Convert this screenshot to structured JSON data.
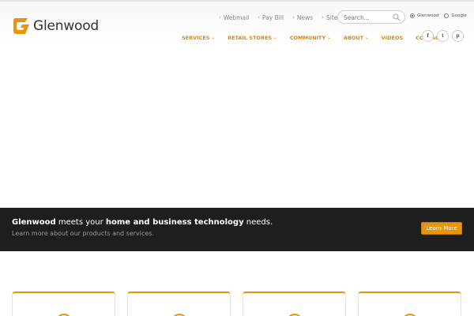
{
  "brand": {
    "name": "Glenwood",
    "accent": "#e8950c"
  },
  "utility_nav": [
    {
      "label": "Webmail"
    },
    {
      "label": "Pay Bill"
    },
    {
      "label": "News"
    },
    {
      "label": "Sites"
    }
  ],
  "search": {
    "placeholder": "Search..."
  },
  "search_scope": [
    {
      "label": "Glenwood",
      "selected": true
    },
    {
      "label": "Google",
      "selected": false
    }
  ],
  "main_nav": [
    {
      "label": "SERVICES",
      "has_dropdown": true
    },
    {
      "label": "RETAIL STORES",
      "has_dropdown": true
    },
    {
      "label": "COMMUNITY",
      "has_dropdown": true
    },
    {
      "label": "ABOUT",
      "has_dropdown": true
    },
    {
      "label": "VIDEOS",
      "has_dropdown": false
    },
    {
      "label": "CONTACT",
      "has_dropdown": false
    }
  ],
  "social": [
    {
      "glyph": "f",
      "icon": "facebook-icon"
    },
    {
      "glyph": "t",
      "icon": "twitter-icon"
    },
    {
      "glyph": "p",
      "icon": "pinterest-icon"
    }
  ],
  "banner": {
    "brand": "Glenwood",
    "middle": " meets your ",
    "emphasis": "home and business technology",
    "end": " needs.",
    "subtext": "Learn more about our products and services.",
    "cta_label": "Learn More"
  },
  "cards": [
    {},
    {},
    {},
    {}
  ]
}
